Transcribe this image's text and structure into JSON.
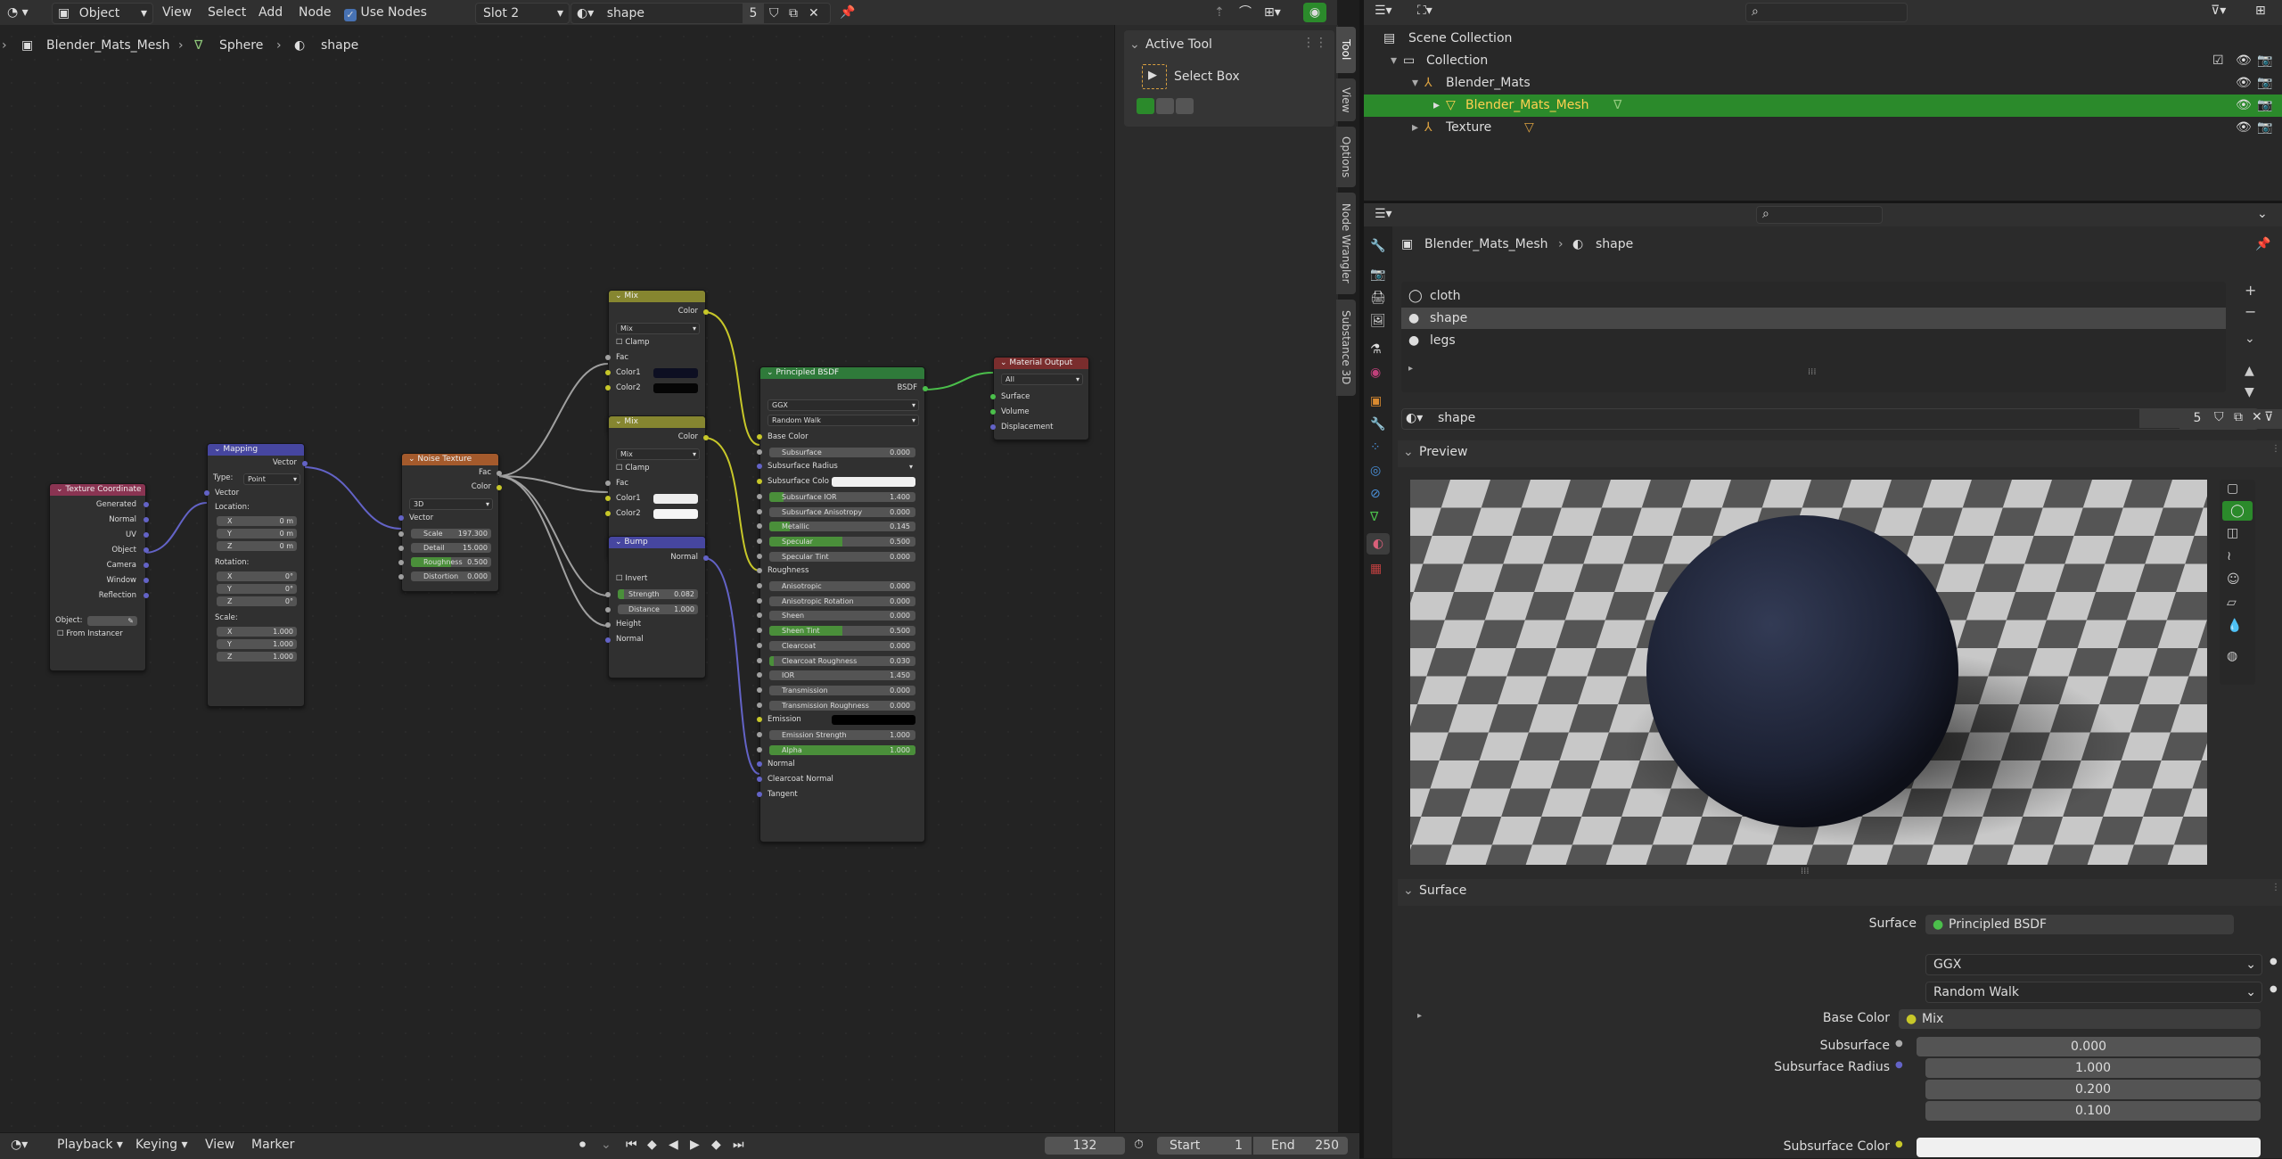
{
  "header": {
    "mode": "Object",
    "menus": [
      "View",
      "Select",
      "Add",
      "Node"
    ],
    "use_nodes": "Use Nodes",
    "slot": "Slot 2",
    "material_name": "shape",
    "users": "5"
  },
  "breadcrumb": {
    "object": "Blender_Mats_Mesh",
    "mesh": "Sphere",
    "material": "shape"
  },
  "active_tool": {
    "title": "Active Tool",
    "tool": "Select Box"
  },
  "side_tabs": [
    "Tool",
    "View",
    "Options",
    "Node Wrangler",
    "Substance 3D"
  ],
  "nodes": {
    "texcoord": {
      "title": "Texture Coordinate",
      "outputs": [
        "Generated",
        "Normal",
        "UV",
        "Object",
        "Camera",
        "Window",
        "Reflection"
      ],
      "object_label": "Object:",
      "from_instancer": "From Instancer"
    },
    "mapping": {
      "title": "Mapping",
      "vector_out": "Vector",
      "type_label": "Type:",
      "type_value": "Point",
      "vector_in": "Vector",
      "location": "Location:",
      "rotation": "Rotation:",
      "scale": "Scale:",
      "loc": [
        [
          "X",
          "0 m"
        ],
        [
          "Y",
          "0 m"
        ],
        [
          "Z",
          "0 m"
        ]
      ],
      "rot": [
        [
          "X",
          "0°"
        ],
        [
          "Y",
          "0°"
        ],
        [
          "Z",
          "0°"
        ]
      ],
      "scl": [
        [
          "X",
          "1.000"
        ],
        [
          "Y",
          "1.000"
        ],
        [
          "Z",
          "1.000"
        ]
      ]
    },
    "noise": {
      "title": "Noise Texture",
      "out_fac": "Fac",
      "out_color": "Color",
      "dim": "3D",
      "vector": "Vector",
      "fields": [
        [
          "Scale",
          "197.300"
        ],
        [
          "Detail",
          "15.000"
        ],
        [
          "Roughness",
          "0.500"
        ],
        [
          "Distortion",
          "0.000"
        ]
      ]
    },
    "mix1": {
      "title": "Mix",
      "out": "Color",
      "blend": "Mix",
      "clamp": "Clamp",
      "fac": "Fac",
      "c1": "Color1",
      "c2": "Color2"
    },
    "mix2": {
      "title": "Mix",
      "out": "Color",
      "blend": "Mix",
      "clamp": "Clamp",
      "fac": "Fac",
      "c1": "Color1",
      "c2": "Color2"
    },
    "bump": {
      "title": "Bump",
      "out": "Normal",
      "invert": "Invert",
      "fields": [
        [
          "Strength",
          "0.082"
        ],
        [
          "Distance",
          "1.000"
        ]
      ],
      "height": "Height",
      "normal": "Normal"
    },
    "bsdf": {
      "title": "Principled BSDF",
      "out": "BSDF",
      "dist": "GGX",
      "sss": "Random Walk",
      "rows": [
        {
          "label": "Base Color",
          "type": "socket"
        },
        {
          "label": "Subsurface",
          "value": "0.000"
        },
        {
          "label": "Subsurface Radius",
          "type": "dropdown"
        },
        {
          "label": "Subsurface Colo",
          "type": "color"
        },
        {
          "label": "Subsurface IOR",
          "value": "1.400",
          "fill": 0.1
        },
        {
          "label": "Subsurface Anisotropy",
          "value": "0.000"
        },
        {
          "label": "Metallic",
          "value": "0.145",
          "fill": 0.14
        },
        {
          "label": "Specular",
          "value": "0.500",
          "fill": 0.5
        },
        {
          "label": "Specular Tint",
          "value": "0.000"
        },
        {
          "label": "Roughness",
          "type": "socket"
        },
        {
          "label": "Anisotropic",
          "value": "0.000"
        },
        {
          "label": "Anisotropic Rotation",
          "value": "0.000"
        },
        {
          "label": "Sheen",
          "value": "0.000"
        },
        {
          "label": "Sheen Tint",
          "value": "0.500",
          "fill": 0.5
        },
        {
          "label": "Clearcoat",
          "value": "0.000"
        },
        {
          "label": "Clearcoat Roughness",
          "value": "0.030",
          "fill": 0.03
        },
        {
          "label": "IOR",
          "value": "1.450"
        },
        {
          "label": "Transmission",
          "value": "0.000"
        },
        {
          "label": "Transmission Roughness",
          "value": "0.000"
        },
        {
          "label": "Emission",
          "type": "color_dark"
        },
        {
          "label": "Emission Strength",
          "value": "1.000"
        },
        {
          "label": "Alpha",
          "value": "1.000",
          "fill": 1.0
        },
        {
          "label": "Normal",
          "type": "socket"
        },
        {
          "label": "Clearcoat Normal",
          "type": "socket"
        },
        {
          "label": "Tangent",
          "type": "socket"
        }
      ]
    },
    "output": {
      "title": "Material Output",
      "target": "All",
      "inputs": [
        "Surface",
        "Volume",
        "Displacement"
      ]
    }
  },
  "outliner": {
    "items": [
      {
        "label": "Scene Collection"
      },
      {
        "label": "Collection"
      },
      {
        "label": "Blender_Mats"
      },
      {
        "label": "Blender_Mats_Mesh"
      },
      {
        "label": "Texture"
      }
    ]
  },
  "properties": {
    "breadcrumb_object": "Blender_Mats_Mesh",
    "breadcrumb_material": "shape",
    "slots": [
      "cloth",
      "shape",
      "legs"
    ],
    "material_name": "shape",
    "users": "5",
    "preview_title": "Preview",
    "surface_title": "Surface",
    "surface_label": "Surface",
    "surface_value": "Principled BSDF",
    "dist": "GGX",
    "sss": "Random Walk",
    "base_color_label": "Base Color",
    "base_color_value": "Mix",
    "subsurface_label": "Subsurface",
    "subsurface_value": "0.000",
    "radius_label": "Subsurface Radius",
    "radius": [
      "1.000",
      "0.200",
      "0.100"
    ],
    "sss_color_label": "Subsurface Color"
  },
  "timeline": {
    "menus": [
      "Playback",
      "Keying",
      "View",
      "Marker"
    ],
    "frame": "132",
    "start_label": "Start",
    "start": "1",
    "end_label": "End",
    "end": "250"
  },
  "colors": {
    "texcoord": "#8a3452",
    "mapping": "#4646a0",
    "noise": "#a45a2c",
    "mix": "#868630",
    "bump": "#4646a0",
    "bsdf": "#2f7a3a",
    "output": "#7a2d2d",
    "highlight_row": "#2b8a2b",
    "accent_green": "#4a8f3a"
  }
}
